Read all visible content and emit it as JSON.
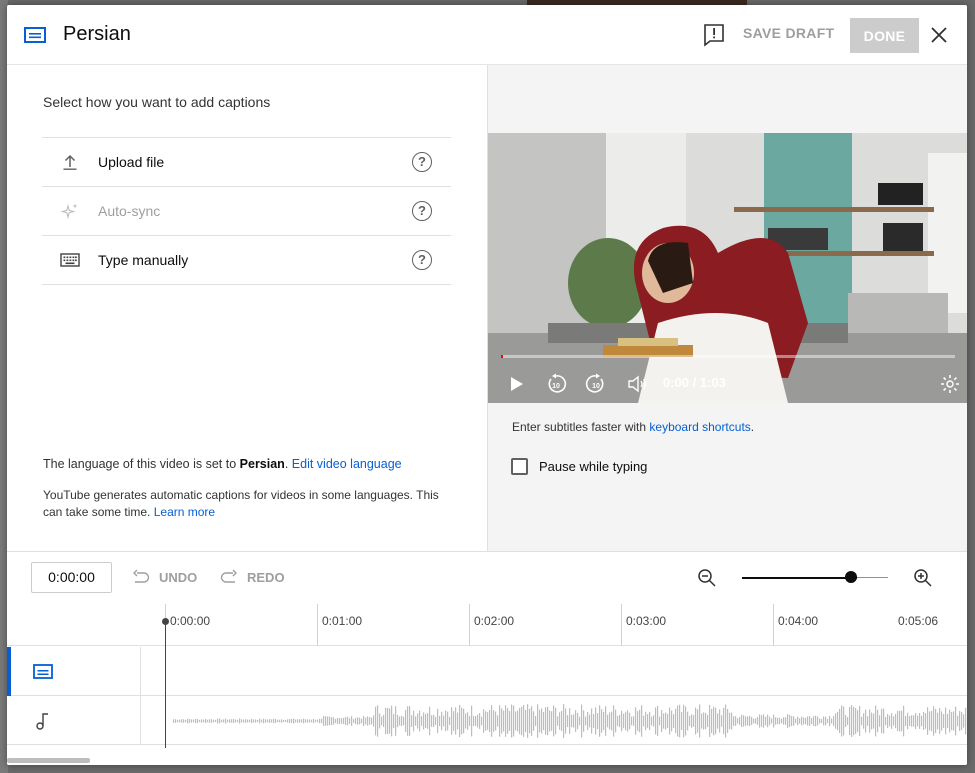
{
  "header": {
    "title": "Persian",
    "save_draft_label": "SAVE DRAFT",
    "done_label": "DONE"
  },
  "left_panel": {
    "prompt": "Select how you want to add captions",
    "options": [
      {
        "label": "Upload file",
        "icon": "upload-icon",
        "enabled": true
      },
      {
        "label": "Auto-sync",
        "icon": "sparkle-icon",
        "enabled": false
      },
      {
        "label": "Type manually",
        "icon": "keyboard-icon",
        "enabled": true
      }
    ],
    "help_glyph": "?",
    "lang_note_prefix": "The language of this video is set to ",
    "lang_note_language": "Persian",
    "lang_note_suffix": ".",
    "edit_language_link": "Edit video language",
    "auto_note": "YouTube generates automatic captions for videos in some languages. This can take some time.",
    "learn_more_link": "Learn more"
  },
  "right_panel": {
    "video_time": "0:00 / 1:03",
    "progress": 0.0,
    "shortcuts_prefix": "Enter subtitles faster with ",
    "shortcuts_link": "keyboard shortcuts",
    "shortcuts_suffix": ".",
    "pause_label": "Pause while typing",
    "pause_checked": false
  },
  "timeline": {
    "timecode": "0:00:00",
    "undo_label": "UNDO",
    "redo_label": "REDO",
    "zoom_level": 0.8,
    "ticks": [
      "0:00:00",
      "0:01:00",
      "0:02:00",
      "0:03:00",
      "0:04:00",
      "0:05:06"
    ]
  },
  "colors": {
    "accent": "#065fd4",
    "disabled": "#9e9e9e",
    "done_bg": "#cccccc"
  }
}
